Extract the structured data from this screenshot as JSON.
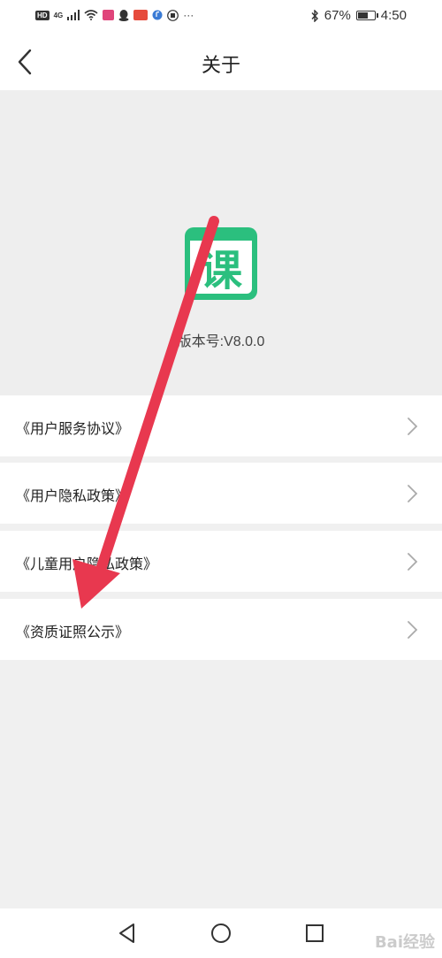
{
  "status_bar": {
    "network": "4G",
    "battery_percent": "67%",
    "battery_level": 0.67,
    "time": "4:50",
    "more": "···"
  },
  "header": {
    "title": "关于",
    "back_icon": "chevron-left-icon"
  },
  "app": {
    "logo_char": "课",
    "logo_color": "#2bbf7e",
    "version": "版本号:V8.0.0"
  },
  "menu": {
    "items": [
      {
        "label": "《用户服务协议》",
        "icon": "chevron-right-icon"
      },
      {
        "label": "《用户隐私政策》",
        "icon": "chevron-right-icon"
      },
      {
        "label": "《儿童用户隐私政策》",
        "icon": "chevron-right-icon"
      },
      {
        "label": "《资质证照公示》",
        "icon": "chevron-right-icon"
      }
    ]
  },
  "nav": {
    "back_icon": "triangle-back-icon",
    "home_icon": "circle-home-icon",
    "recent_icon": "square-recent-icon"
  },
  "watermark": {
    "text": "Bai经验"
  },
  "annotation": {
    "arrow_color": "#e8384f"
  }
}
